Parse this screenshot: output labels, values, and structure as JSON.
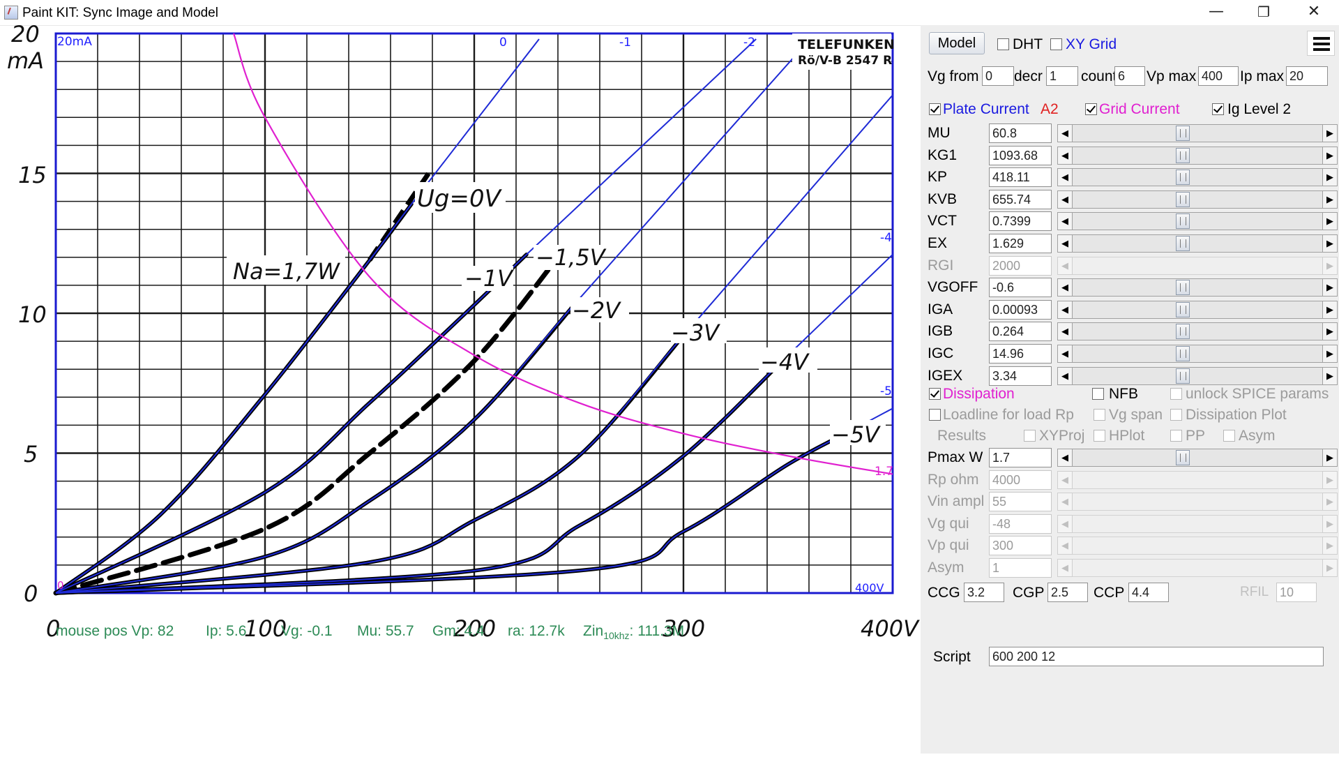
{
  "window": {
    "title": "Paint KIT: Sync Image and Model",
    "minimize_glyph": "—",
    "maximize_glyph": "❐",
    "close_glyph": "✕"
  },
  "chart": {
    "y_unit_top": "20",
    "y_unit_label": "mA",
    "y_ticks": [
      "0",
      "5",
      "10",
      "15"
    ],
    "x_ticks": [
      "0",
      "100",
      "200",
      "300"
    ],
    "x_end_label": "400V",
    "brand": "TELEFUNKEN",
    "brand_sub": "Rö/V-B 2547 R",
    "corner_top_left": "20mA",
    "corner_bottom_left": "0",
    "corner_bottom_right": "400V",
    "na_label": "Na=1,7W",
    "ug_label": "Ug=0V",
    "curve_labels": [
      "−1V",
      "−1,5V",
      "−2V",
      "−3V",
      "−4V",
      "−5V"
    ],
    "model_labels": [
      "0",
      "-1",
      "-2",
      "-3",
      "-4",
      "-5"
    ],
    "dissipation_label": "1.7"
  },
  "chart_data": {
    "type": "line",
    "title": "",
    "xlabel": "400V",
    "ylabel": "mA",
    "xlim": [
      0,
      400
    ],
    "ylim": [
      0,
      20
    ],
    "grid": true,
    "series": [
      {
        "name": "Ug=0V",
        "x": [
          0,
          50,
          100,
          150,
          170
        ],
        "y": [
          0,
          2.8,
          7.1,
          11.9,
          13.9
        ]
      },
      {
        "name": "−1V",
        "x": [
          0,
          100,
          150,
          200,
          225
        ],
        "y": [
          0,
          3.6,
          6.8,
          10.3,
          12.1
        ]
      },
      {
        "name": "−1,5V",
        "x": [
          0,
          100,
          150,
          200,
          240
        ],
        "y": [
          0,
          2.3,
          5.0,
          8.3,
          12.0
        ]
      },
      {
        "name": "−2V",
        "x": [
          0,
          100,
          150,
          200,
          250
        ],
        "y": [
          0,
          1.3,
          3.3,
          6.2,
          10.5
        ]
      },
      {
        "name": "−3V",
        "x": [
          0,
          150,
          200,
          250,
          300
        ],
        "y": [
          0,
          1.1,
          2.6,
          4.9,
          9.2
        ]
      },
      {
        "name": "−4V",
        "x": [
          0,
          200,
          250,
          300,
          350
        ],
        "y": [
          0,
          0.8,
          2.4,
          4.9,
          8.5
        ]
      },
      {
        "name": "−5V",
        "x": [
          0,
          250,
          300,
          350,
          380
        ],
        "y": [
          0,
          0.8,
          2.2,
          4.6,
          5.8
        ]
      },
      {
        "name": "1.7",
        "x": [
          85,
          100,
          150,
          200,
          250,
          300,
          350,
          400
        ],
        "y": [
          20,
          17.0,
          11.3,
          8.5,
          6.8,
          5.7,
          4.9,
          4.25
        ]
      }
    ]
  },
  "readout": {
    "mouse_pos": "mouse pos Vp: 82",
    "ip": "Ip: 5.6",
    "vg": "Vg: -0.1",
    "mu": "Mu: 55.7",
    "gm": "Gm: 4.4",
    "ra": "ra: 12.7k",
    "zin_prefix": "Zin",
    "zin_sub": "10khz",
    "zin_value": ": 111.3M"
  },
  "panel": {
    "model_button": "Model",
    "dht": "DHT",
    "xy_grid": "XY Grid",
    "menu_icon": "menu-icon",
    "vg_from_label": "Vg from",
    "vg_from": "0",
    "decr_label": "decr",
    "decr": "1",
    "count_label": "count",
    "count": "6",
    "vp_max_label": "Vp max",
    "vp_max": "400",
    "ip_max_label": "Ip max",
    "ip_max": "20",
    "plate_current": "Plate Current",
    "a2": "A2",
    "grid_current": "Grid Current",
    "ig_level": "Ig Level 2",
    "params": [
      {
        "name": "MU",
        "value": "60.8",
        "enabled": true
      },
      {
        "name": "KG1",
        "value": "1093.68",
        "enabled": true
      },
      {
        "name": "KP",
        "value": "418.11",
        "enabled": true
      },
      {
        "name": "KVB",
        "value": "655.74",
        "enabled": true
      },
      {
        "name": "VCT",
        "value": "0.7399",
        "enabled": true
      },
      {
        "name": "EX",
        "value": "1.629",
        "enabled": true
      },
      {
        "name": "RGI",
        "value": "2000",
        "enabled": false
      },
      {
        "name": "VGOFF",
        "value": "-0.6",
        "enabled": true
      },
      {
        "name": "IGA",
        "value": "0.00093",
        "enabled": true
      },
      {
        "name": "IGB",
        "value": "0.264",
        "enabled": true
      },
      {
        "name": "IGC",
        "value": "14.96",
        "enabled": true
      },
      {
        "name": "IGEX",
        "value": "3.34",
        "enabled": true
      }
    ],
    "dissipation": "Dissipation",
    "nfb": "NFB",
    "unlock_spice": "unlock SPICE params",
    "loadline": "Loadline for load Rp",
    "vg_span": "Vg span",
    "dissipation_plot": "Dissipation Plot",
    "results": "Results",
    "xyproj": "XYProj",
    "hplot": "HPlot",
    "pp": "PP",
    "asym_chk": "Asym",
    "params2": [
      {
        "name": "Pmax W",
        "value": "1.7",
        "enabled": true
      },
      {
        "name": "Rp ohm",
        "value": "4000",
        "enabled": false
      },
      {
        "name": "Vin ampl",
        "value": "55",
        "enabled": false
      },
      {
        "name": "Vg qui",
        "value": "-48",
        "enabled": false
      },
      {
        "name": "Vp qui",
        "value": "300",
        "enabled": false
      },
      {
        "name": "Asym",
        "value": "1",
        "enabled": false
      }
    ],
    "ccg_label": "CCG",
    "ccg": "3.2",
    "cgp_label": "CGP",
    "cgp": "2.5",
    "ccp_label": "CCP",
    "ccp": "4.4",
    "rfil_label": "RFIL",
    "rfil": "10",
    "script_label": "Script",
    "script": "600 200 12"
  },
  "colors": {
    "model_curve": "#1f2bd6",
    "dissipation": "#e020d0",
    "readout": "#2e8b57",
    "a2": "#e02020",
    "panel_bg": "#eeeeee"
  }
}
